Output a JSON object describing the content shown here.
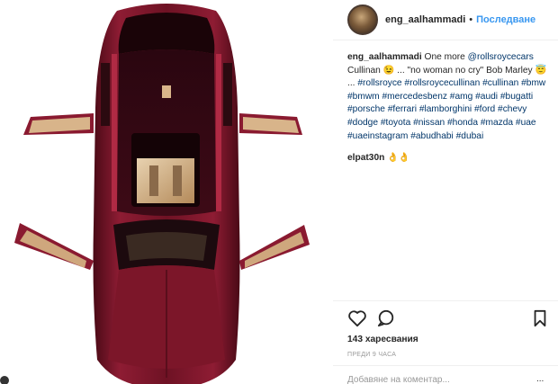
{
  "post": {
    "username": "eng_aalhammadi",
    "separator": "•",
    "follow_label": "Последване",
    "caption": {
      "username": "eng_aalhammadi",
      "text_1": "One more",
      "mention": "@rollsroycecars",
      "text_2": "Cullinan 😉 ... \"no woman no cry\" Bob Marley 😇 ...",
      "hashtags": "#rollsroyce #rollsroycecullinan #cullinan #bmw #bmwm #mercedesbenz #amg #audi #bugatti #porsche #ferrari #lamborghini #ford #chevy #dodge #toyota #nissan #honda #mazda #uae #uaeinstagram #abudhabi #dubai"
    },
    "comment": {
      "username": "elpat30n",
      "text": "👌👌"
    },
    "likes": "143 харесвания",
    "time": "преди 9 часа",
    "add_comment_placeholder": "Добавяне на коментар...",
    "more_label": "..."
  },
  "icons": {
    "like": "heart-icon",
    "comment": "comment-icon",
    "save": "bookmark-icon",
    "avatar": "avatar",
    "media": "car-top-view-photo"
  },
  "colors": {
    "link": "#003569",
    "follow": "#3897f0",
    "car_body": "#7a1426",
    "text": "#262626",
    "muted": "#999999"
  }
}
